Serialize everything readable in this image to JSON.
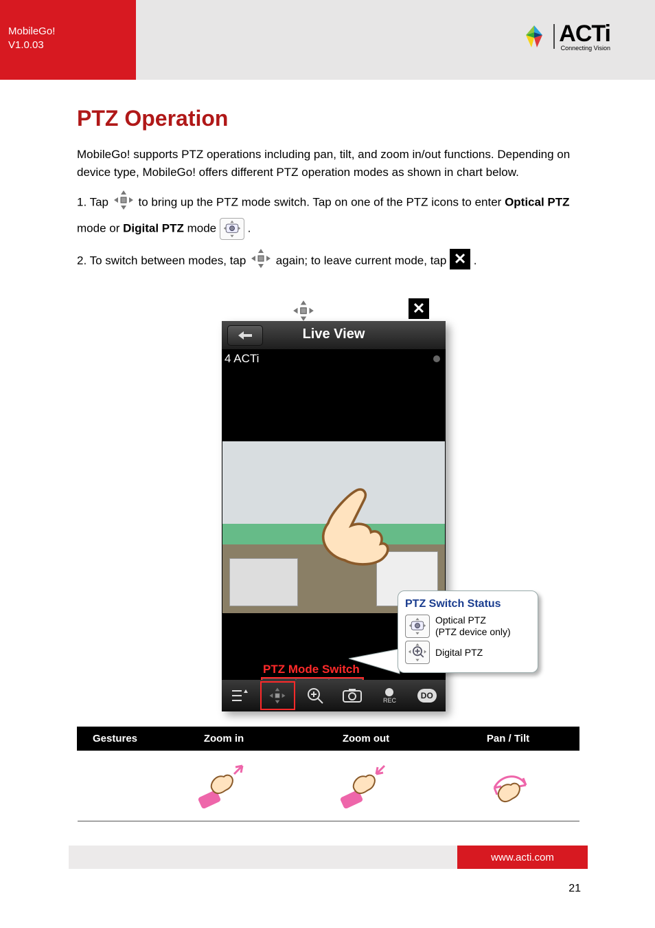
{
  "header": {
    "product": "MobileGo!",
    "version": "V1.0.03",
    "logo_text": "ACTi",
    "logo_sub": "Connecting Vision"
  },
  "body": {
    "heading": "PTZ Operation",
    "intro": "MobileGo! supports PTZ operations including pan, tilt, and zoom in/out functions. Depending on device type, MobileGo! offers different PTZ operation modes as shown in chart below.",
    "step1_pre": "1. Tap  ",
    "step1_mid": "  to bring up the PTZ mode switch. Tap on one of the PTZ icons to enter ",
    "step1_bold1": "Optical PTZ",
    "step1_mid2": " mode or ",
    "step1_bold2": "Digital PTZ",
    "step1_after": " mode ",
    "step1_end": ".",
    "step2_pre": "2. To switch between modes, tap ",
    "step2_mid": " again; to leave current mode, tap ",
    "step2_end": "."
  },
  "phone": {
    "title": "Live View",
    "camera_label": "4 ACTi",
    "ptz_mode_switch_label": "PTZ Mode Switch",
    "toolbar": {
      "rec_label": "REC",
      "do_label": "DO"
    }
  },
  "callout": {
    "title": "PTZ Switch Status",
    "row1_line1": "Optical PTZ",
    "row1_line2": "(PTZ device only)",
    "row2": "Digital PTZ"
  },
  "table": {
    "headers": [
      "Gestures",
      "Zoom in",
      "Zoom out",
      "Pan / Tilt"
    ]
  },
  "footer": {
    "url": "www.acti.com",
    "page": "21"
  }
}
